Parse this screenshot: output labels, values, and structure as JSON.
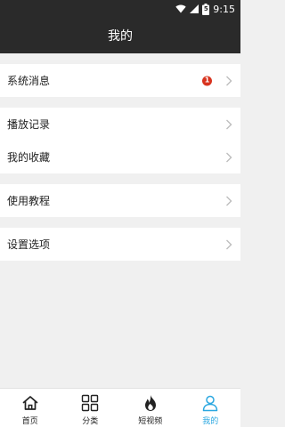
{
  "status_bar": {
    "time": "9:15",
    "battery_level": "5",
    "icons": [
      "wifi-icon",
      "signal-icon",
      "battery-icon"
    ]
  },
  "header": {
    "title": "我的"
  },
  "sections": [
    {
      "items": [
        {
          "label": "系统消息",
          "badge": "1"
        }
      ]
    },
    {
      "items": [
        {
          "label": "播放记录"
        },
        {
          "label": "我的收藏"
        }
      ]
    },
    {
      "items": [
        {
          "label": "使用教程"
        }
      ]
    },
    {
      "items": [
        {
          "label": "设置选项"
        }
      ]
    }
  ],
  "bottom_nav": {
    "items": [
      {
        "label": "首页",
        "icon": "home-icon"
      },
      {
        "label": "分类",
        "icon": "grid-icon"
      },
      {
        "label": "短视频",
        "icon": "flame-icon"
      },
      {
        "label": "我的",
        "icon": "user-icon",
        "active": true
      }
    ]
  },
  "colors": {
    "header_bg": "#2a2a2a",
    "page_bg": "#f0f0f0",
    "badge": "#d8341f",
    "active_tab": "#2aa7e0"
  }
}
